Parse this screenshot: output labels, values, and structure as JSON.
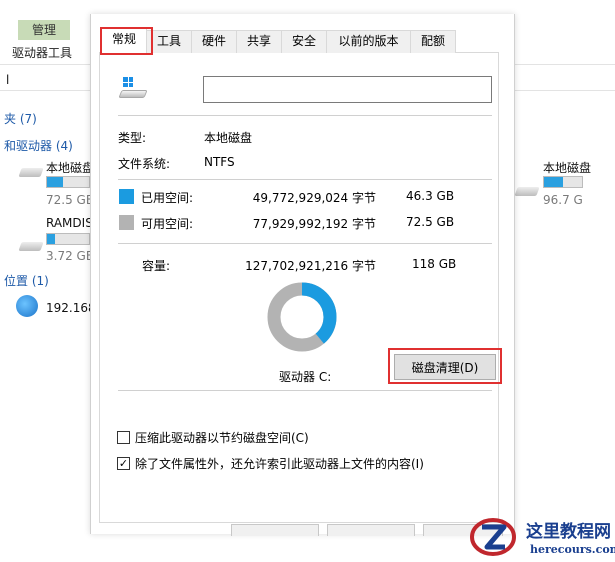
{
  "background": {
    "ribbon_tab": "管理",
    "ribbon_subtab": "驱动器工具",
    "sections": {
      "folders": "夹 (7)",
      "devices": "和驱动器 (4)",
      "network": "位置 (1)"
    },
    "drives": [
      {
        "name": "本地磁盘",
        "free": "72.5 GB",
        "used_fraction": 0.37
      },
      {
        "name": "RAMDIS",
        "free": "3.72 GB",
        "used_fraction": 0.2
      },
      {
        "name": "本地磁盘",
        "free": "96.7 G",
        "used_fraction": 0.5
      }
    ],
    "network_item": "192.168"
  },
  "dialog": {
    "tabs": [
      {
        "label": "常规",
        "active": true
      },
      {
        "label": "工具",
        "active": false
      },
      {
        "label": "硬件",
        "active": false
      },
      {
        "label": "共享",
        "active": false
      },
      {
        "label": "安全",
        "active": false
      },
      {
        "label": "以前的版本",
        "active": false
      },
      {
        "label": "配额",
        "active": false
      }
    ],
    "volume_name": "",
    "type_label": "类型:",
    "type_value": "本地磁盘",
    "fs_label": "文件系统:",
    "fs_value": "NTFS",
    "used": {
      "label": "已用空间:",
      "bytes": "49,772,929,024 字节",
      "size": "46.3 GB",
      "color": "#1b9be0"
    },
    "free": {
      "label": "可用空间:",
      "bytes": "77,929,992,192 字节",
      "size": "72.5 GB",
      "color": "#b3b3b3"
    },
    "capacity": {
      "label": "容量:",
      "bytes": "127,702,921,216 字节",
      "size": "118 GB"
    },
    "usage_fraction": 0.3898,
    "drive_label": "驱动器 C:",
    "cleanup_button": "磁盘清理(D)",
    "checkboxes": [
      {
        "label": "压缩此驱动器以节约磁盘空间(C)",
        "checked": false
      },
      {
        "label": "除了文件属性外，还允许索引此驱动器上文件的内容(I)",
        "checked": true
      }
    ]
  },
  "watermark": {
    "title": "这里教程网",
    "url": "herecours.com"
  }
}
